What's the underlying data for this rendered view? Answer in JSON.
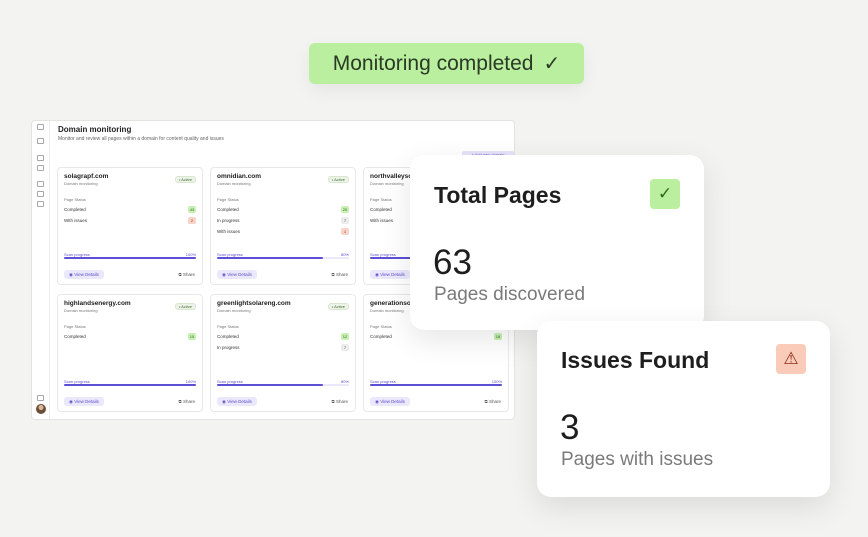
{
  "toast": {
    "text": "Monitoring completed",
    "icon": "check-icon"
  },
  "app": {
    "title": "Domain monitoring",
    "subtitle": "Monitor and review all pages within a domain for content quality and issues",
    "add_button": "+ Add new domain",
    "rail_icons": [
      "logo-icon",
      "file-icon",
      "document-icon",
      "copy-icon",
      "page-icon",
      "grid-icon",
      "layers-icon",
      "share-icon",
      "bell-icon"
    ],
    "cards": [
      {
        "domain": "solagrapf.com",
        "sub": "Domain monitoring",
        "badge": "• Active",
        "status_label": "Page Status",
        "rows": [
          {
            "label": "Completed",
            "value": "43",
            "tone": "green"
          },
          {
            "label": "With issues",
            "value": "2",
            "tone": "red"
          }
        ],
        "scan_label": "Scan progress",
        "scan_value": "100%",
        "progress": 1.0,
        "view": "View Details",
        "share": "Share"
      },
      {
        "domain": "omnidian.com",
        "sub": "Domain monitoring",
        "badge": "• Active",
        "status_label": "Page Status",
        "rows": [
          {
            "label": "Completed",
            "value": "20",
            "tone": "green"
          },
          {
            "label": "In progress",
            "value": "7",
            "tone": "gray"
          },
          {
            "label": "With issues",
            "value": "1",
            "tone": "red"
          }
        ],
        "scan_label": "Scan progress",
        "scan_value": "80%",
        "progress": 0.8,
        "view": "View Details",
        "share": "Share"
      },
      {
        "domain": "northvalleyso",
        "sub": "Domain monitoring",
        "badge": "",
        "status_label": "Page Status",
        "rows": [
          {
            "label": "Completed",
            "value": "",
            "tone": "green"
          },
          {
            "label": "With issues",
            "value": "",
            "tone": "red"
          }
        ],
        "scan_label": "Scan progress",
        "scan_value": "",
        "progress": 1.0,
        "view": "View Details",
        "share": ""
      },
      {
        "domain": "highlandsenergy.com",
        "sub": "Domain monitoring",
        "badge": "• Active",
        "status_label": "Page Status",
        "rows": [
          {
            "label": "Completed",
            "value": "15",
            "tone": "green"
          }
        ],
        "scan_label": "Scan progress",
        "scan_value": "100%",
        "progress": 1.0,
        "view": "View Details",
        "share": "Share"
      },
      {
        "domain": "greenlightsolareng.com",
        "sub": "Domain monitoring",
        "badge": "• Active",
        "status_label": "Page Status",
        "rows": [
          {
            "label": "Completed",
            "value": "12",
            "tone": "green"
          },
          {
            "label": "In progress",
            "value": "7",
            "tone": "gray"
          }
        ],
        "scan_label": "Scan progress",
        "scan_value": "80%",
        "progress": 0.8,
        "view": "View Details",
        "share": "Share"
      },
      {
        "domain": "generationsola",
        "sub": "Domain monitoring",
        "badge": "",
        "status_label": "Page Status",
        "rows": [
          {
            "label": "Completed",
            "value": "18",
            "tone": "green"
          }
        ],
        "scan_label": "Scan progress",
        "scan_value": "100%",
        "progress": 1.0,
        "view": "View Details",
        "share": "Share"
      }
    ]
  },
  "total_pages": {
    "title": "Total Pages",
    "value": "63",
    "label": "Pages discovered",
    "icon": "check-icon",
    "icon_color": "#b9ef9e"
  },
  "issues_found": {
    "title": "Issues Found",
    "value": "3",
    "label": "Pages with issues",
    "icon": "warning-icon",
    "icon_color": "#f9cbb8"
  }
}
